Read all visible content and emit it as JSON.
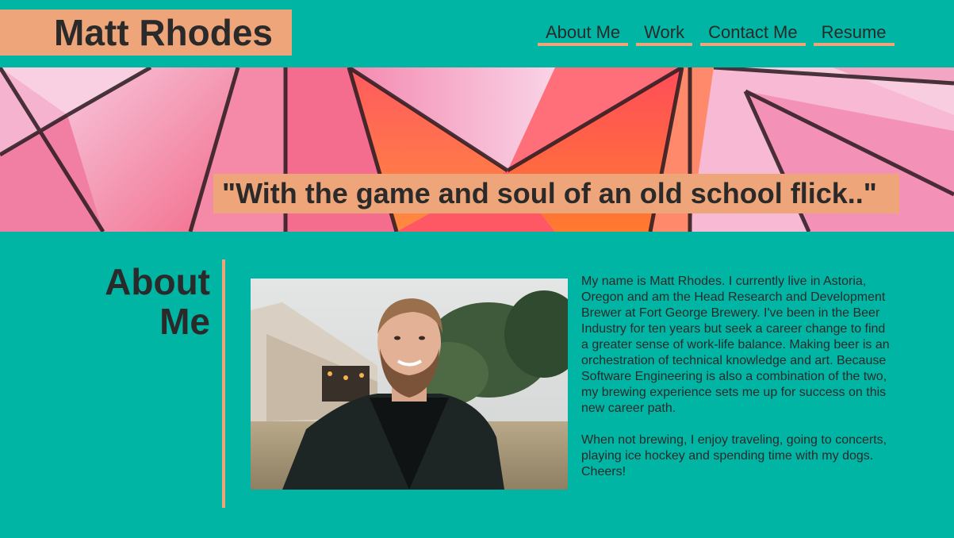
{
  "header": {
    "site_title": "Matt Rhodes",
    "nav": [
      {
        "label": "About Me"
      },
      {
        "label": "Work"
      },
      {
        "label": "Contact Me"
      },
      {
        "label": "Resume"
      }
    ]
  },
  "hero": {
    "tagline": "\"With the game and soul of an old school flick..\""
  },
  "about": {
    "heading_line1": "About",
    "heading_line2": "Me",
    "paragraphs": [
      "My name is Matt Rhodes. I currently live in Astoria, Oregon and am the Head Research and Development Brewer at Fort George Brewery. I've been in the Beer Industry for ten years but seek a career change to find a greater sense of work-life balance. Making beer is an orchestration of technical knowledge and art. Because Software Engineering is also a combination of the two, my brewing experience sets me up for success on this new career path.",
      "When not brewing, I enjoy traveling, going to concerts, playing ice hockey and spending time with my dogs. Cheers!"
    ]
  },
  "colors": {
    "background": "#00b5a3",
    "accent": "#efa57a",
    "text": "#2a2a2a"
  }
}
